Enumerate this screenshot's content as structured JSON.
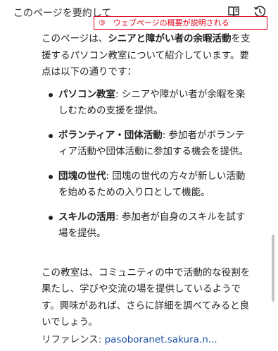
{
  "header": {
    "title": "このページを要約して",
    "icons": [
      "reader-mode-icon",
      "history-icon"
    ]
  },
  "annotation": {
    "text": "③　ウェブページの概要が説明される",
    "color": "#e0001b"
  },
  "summary": {
    "intro_prefix": "このページは、",
    "intro_bold": "シニアと障がい者の余暇活動",
    "intro_suffix": "を支援するパソコン教室について紹介しています。要点は以下の通りです：",
    "bullets": [
      {
        "term": "パソコン教室",
        "text": ": シニアや障がい者が余暇を楽しむための支援を提供。"
      },
      {
        "term": "ボランティア・団体活動",
        "text": ": 参加者がボランティア活動や団体活動に参加する機会を提供。"
      },
      {
        "term": "団塊の世代",
        "text": ": 団塊の世代の方々が新しい活動を始めるための入り口として機能。"
      },
      {
        "term": "スキルの活用",
        "text": ": 参加者が自身のスキルを試す場を提供。"
      }
    ],
    "outro": "この教室は、コミュニティの中で活動的な役割を果たし、学びや交流の場を提供しているようです。興味があれば、さらに詳細を調べてみると良いでしょう。"
  },
  "reference": {
    "label": "リファレンス: ",
    "link_text": "pasoboranet.sakura.n..."
  }
}
